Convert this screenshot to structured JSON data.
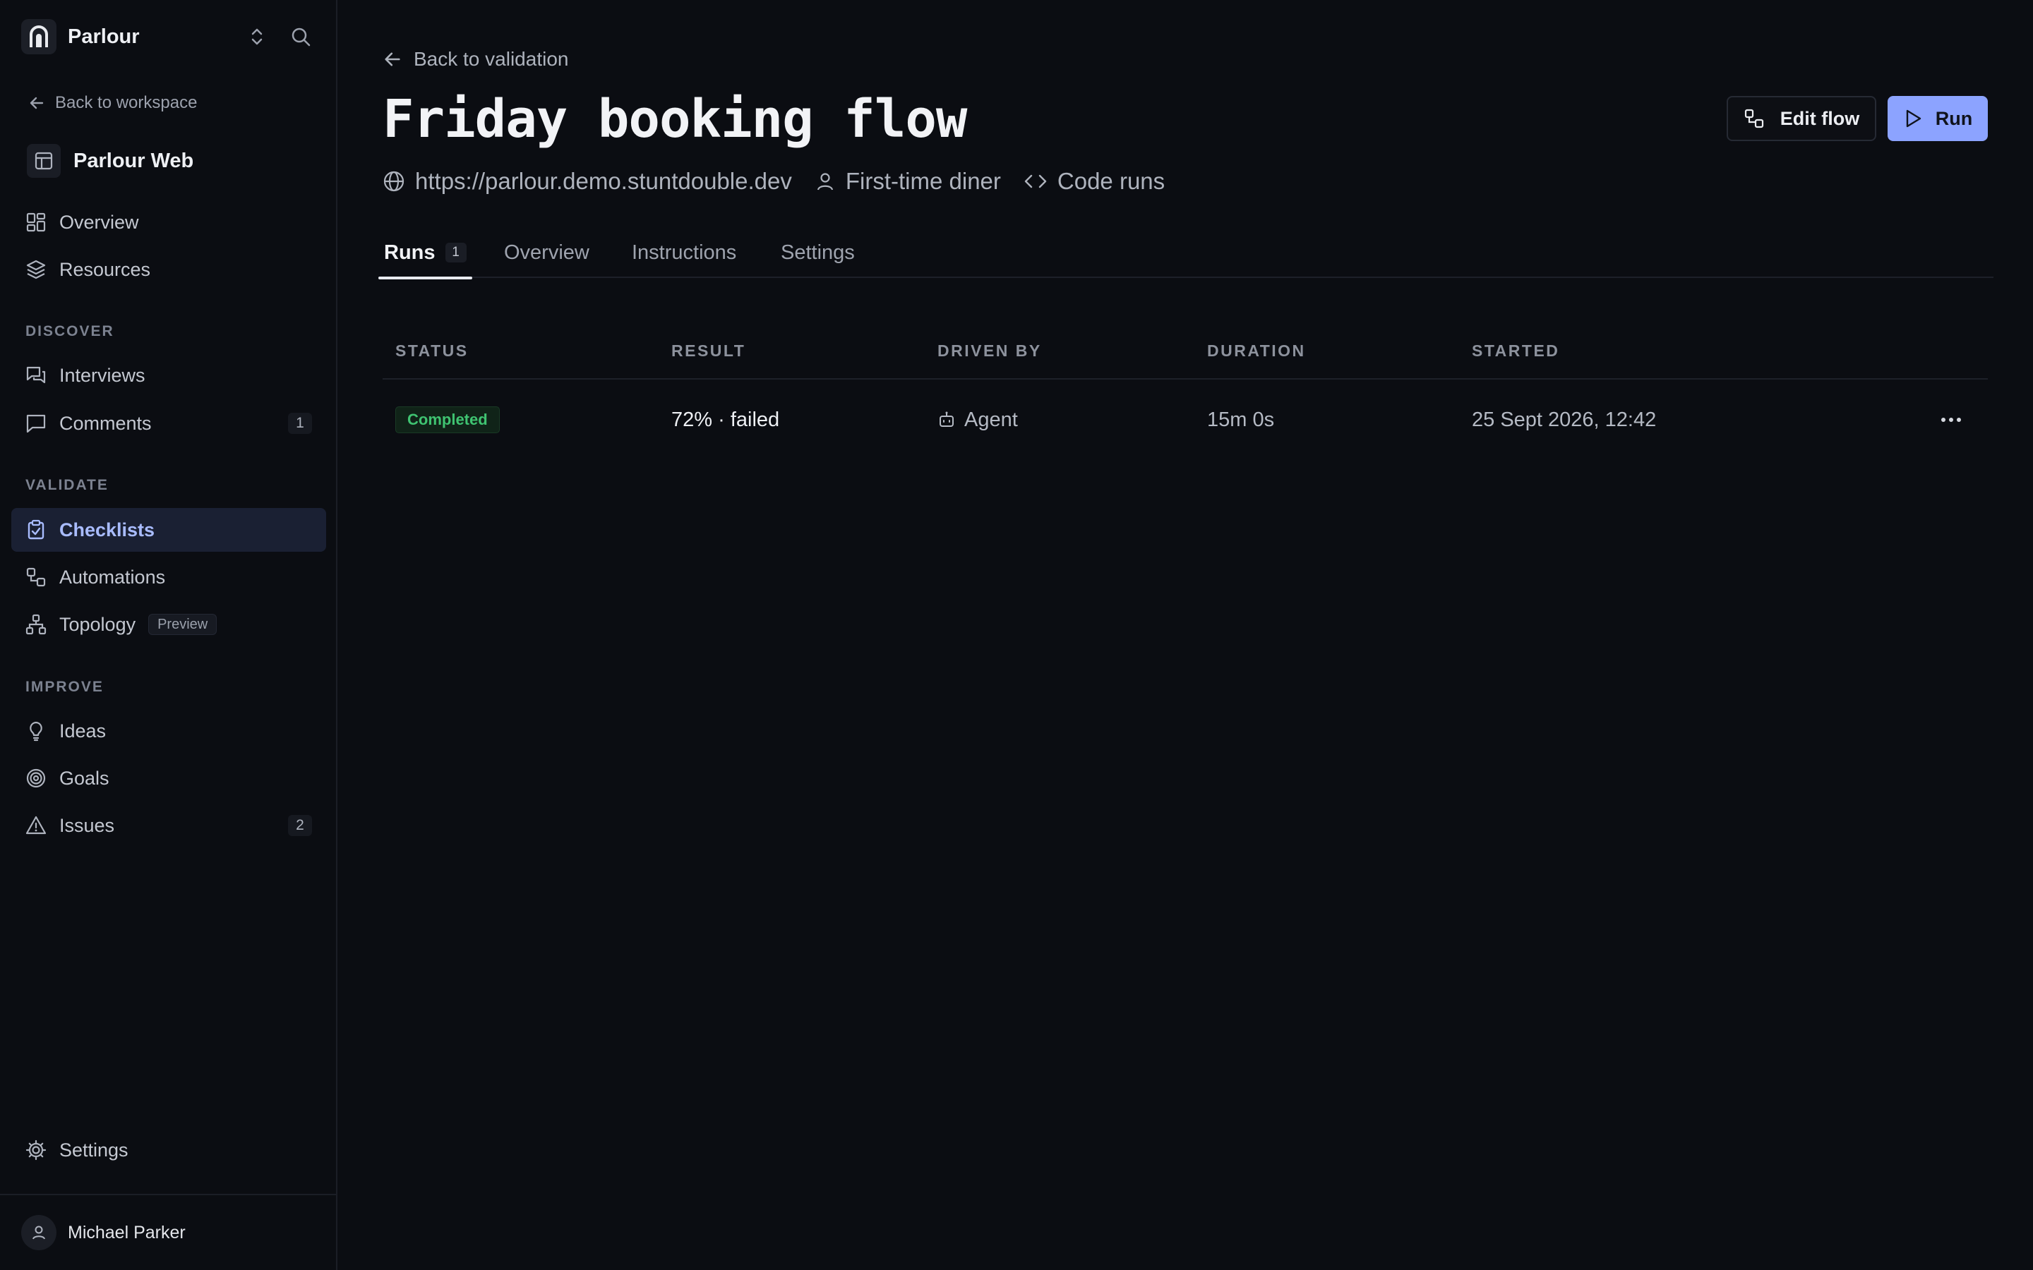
{
  "app": {
    "brand": "Parlour"
  },
  "sidebar": {
    "back_label": "Back to workspace",
    "project_name": "Parlour Web",
    "items_top": [
      {
        "label": "Overview",
        "icon": "grid-icon"
      },
      {
        "label": "Resources",
        "icon": "layers-icon"
      }
    ],
    "sections": {
      "discover": "DISCOVER",
      "validate": "VALIDATE",
      "improve": "IMPROVE"
    },
    "discover_items": [
      {
        "label": "Interviews",
        "icon": "chat-icon"
      },
      {
        "label": "Comments",
        "icon": "comment-icon",
        "badge": "1"
      }
    ],
    "validate_items": [
      {
        "label": "Checklists",
        "icon": "clipboard-icon",
        "active": true
      },
      {
        "label": "Automations",
        "icon": "flow-icon"
      },
      {
        "label": "Topology",
        "icon": "topology-icon",
        "tag": "Preview"
      }
    ],
    "improve_items": [
      {
        "label": "Ideas",
        "icon": "bulb-icon"
      },
      {
        "label": "Goals",
        "icon": "target-icon"
      },
      {
        "label": "Issues",
        "icon": "warning-icon",
        "badge": "2"
      }
    ],
    "settings_label": "Settings",
    "user_name": "Michael Parker"
  },
  "header": {
    "back_label": "Back to validation",
    "title": "Friday booking flow",
    "url": "https://parlour.demo.stuntdouble.dev",
    "persona": "First-time diner",
    "mode": "Code runs",
    "edit_label": "Edit flow",
    "run_label": "Run"
  },
  "tabs": [
    {
      "label": "Runs",
      "count": "1",
      "active": true
    },
    {
      "label": "Overview"
    },
    {
      "label": "Instructions"
    },
    {
      "label": "Settings"
    }
  ],
  "table": {
    "columns": [
      "STATUS",
      "RESULT",
      "DRIVEN BY",
      "DURATION",
      "STARTED"
    ],
    "rows": [
      {
        "status": "Completed",
        "result": "72% · failed",
        "driven_by": "Agent",
        "duration": "15m 0s",
        "started": "25 Sept 2026, 12:42"
      }
    ]
  },
  "colors": {
    "accent": "#8ca3ff",
    "active_nav_bg": "#1a2033",
    "success": "#3fc371",
    "background": "#0b0d12"
  }
}
